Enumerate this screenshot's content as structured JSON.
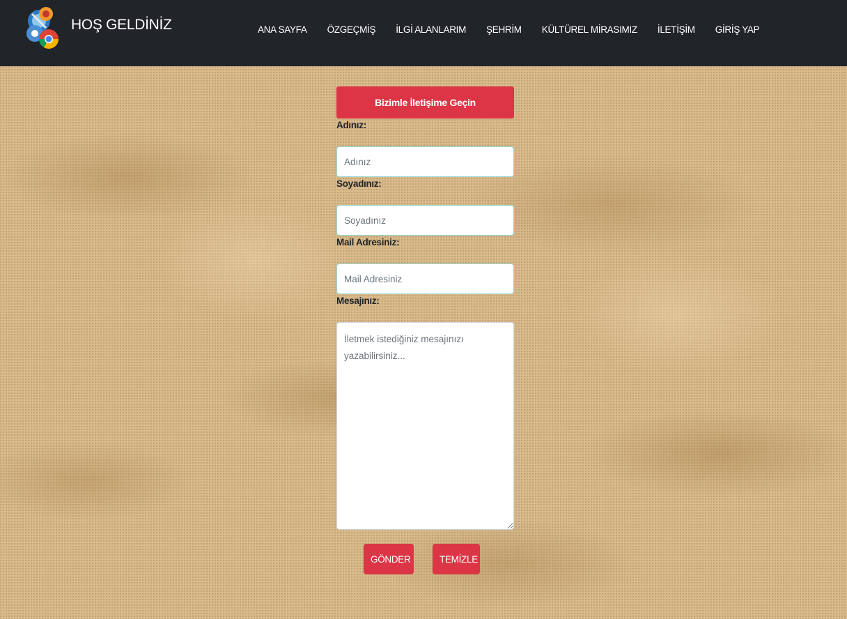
{
  "navbar": {
    "brand_title": "HOŞ GELDİNİZ",
    "logo_icon": "browser-logos-icon",
    "links": [
      "ANA SAYFA",
      "ÖZGEÇMİŞ",
      "İLGİ ALANLARIM",
      "ŞEHRİM",
      "KÜLTÜREL MİRASIMIZ",
      "İLETİŞİM",
      "GİRİŞ YAP"
    ]
  },
  "form": {
    "header": "Bizimle İletişime Geçin",
    "name_label": "Adınız:",
    "name_placeholder": "Adınız",
    "surname_label": "Soyadınız:",
    "surname_placeholder": "Soyadınız",
    "mail_label": "Mail Adresiniz:",
    "mail_placeholder": "Mail Adresiniz",
    "message_label": "Mesajınız:",
    "message_placeholder": "İletmek istediğiniz mesajınızı yazabilirsiniz...",
    "send_label": "GÖNDER",
    "clear_label": "TEMİZLE"
  },
  "colors": {
    "navbar_bg": "#212529",
    "accent_red": "#dc3545",
    "background_sand": "#d9bb8c"
  }
}
